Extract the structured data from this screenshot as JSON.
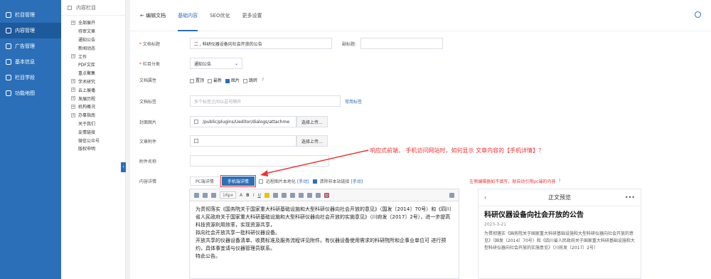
{
  "sidebar": {
    "items": [
      {
        "label": "栏目管理",
        "icon": "gear-icon"
      },
      {
        "label": "内容管理",
        "icon": "document-icon"
      },
      {
        "label": "广告管理",
        "icon": "home-icon"
      },
      {
        "label": "基本信息",
        "icon": "gear-icon"
      },
      {
        "label": "栏目学段",
        "icon": "document-icon"
      },
      {
        "label": "功能地图",
        "icon": "grid-icon"
      }
    ]
  },
  "tree": {
    "title": "内容栏目",
    "items": [
      {
        "label": "全部展开",
        "exp": "+"
      },
      {
        "label": "待审文章",
        "exp": ""
      },
      {
        "label": "通知公告",
        "exp": ""
      },
      {
        "label": "新闻动态",
        "exp": ""
      },
      {
        "label": "工作",
        "exp": "+"
      },
      {
        "label": "PDF文库",
        "exp": ""
      },
      {
        "label": "重点聚集",
        "exp": ""
      },
      {
        "label": "学术研究",
        "exp": "+"
      },
      {
        "label": "云上展播",
        "exp": "+"
      },
      {
        "label": "发展历程",
        "exp": "+"
      },
      {
        "label": "机构概况",
        "exp": "+"
      },
      {
        "label": "办事指南",
        "exp": "+"
      },
      {
        "label": "关于我们",
        "exp": ""
      },
      {
        "label": "友情链接",
        "exp": ""
      },
      {
        "label": "微信公众号",
        "exp": ""
      },
      {
        "label": "版权申明",
        "exp": ""
      }
    ],
    "collapse_glyph": "‹"
  },
  "header": {
    "back": "← 编辑文档",
    "tabs": [
      "基础内容",
      "SEO优化",
      "更多设置"
    ]
  },
  "form": {
    "title_label": "文档标题",
    "title_value": "二                     ,        科研仪器设备向社会开放的公告",
    "subtitle_label": "副标题:",
    "column_label": "栏目分类",
    "column_value": "通知公告",
    "attr_label": "文档属性",
    "attrs": [
      {
        "label": "置顶",
        "on": false
      },
      {
        "label": "最新",
        "on": false
      },
      {
        "label": "图片",
        "on": true
      },
      {
        "label": "跳转",
        "on": false
      }
    ],
    "attr_help": "?",
    "tags_label": "文档标签",
    "tags_placeholder": "多个标签之间以逗号隔开",
    "tags_link": "常用标签",
    "cover_label": "封面图片",
    "cover_value": "/public/plugins/Ueditor/dialogs/attachme",
    "upload": "选择上传...",
    "attach_label": "文章附件",
    "attach_value": "",
    "attachname_label": "附件名称",
    "content_label": "内容详情",
    "pc_btn": "PC端详情",
    "mobile_btn": "手机端详情",
    "remote_label": "远程图片本地化",
    "remote_manual": "[手动]",
    "clear_label": "清除非本站链接",
    "clear_manual": "[手动]",
    "right_hint": "左侧编辑器如不填写，就自动引用pc端的内容",
    "help": "?"
  },
  "annotation": "响应式前端， 手机访问网站时，如何显示 文章内容的【手机详情】？",
  "editor": {
    "fontsize": "16px",
    "paragraphs": [
      "为贯彻落实《国务院关于国家重大科研基础设施和大型科研仪器向社会开放的意见》（国发〔2014〕70号）和《四川省人民政府关于国家重大科研基础设施和大型科研仪器向社会开放的实施意见》（川府发〔2017〕2号），进一步提高科技资源利用效率，实现资源共享，",
      "拟向社会开放共享一批科研仪器设备。",
      "开放共享的仪器设备清单、收费标准及服务流程详见附件。有仪器设备使用需求的科研院所和企事业单位可                  进行预约，具体事宜请与仪器管理员联系。",
      "特此公告。"
    ]
  },
  "preview": {
    "header": "正文预览",
    "back": "‹",
    "more": "•••",
    "title": "科研仪器设备向社会开放的公告",
    "date": "2023-3-21",
    "body": "为贯彻落实《国务院关于国家重大科研基础设施和大型科研仪器向社会开放的意见》（国发〔2014〕70号）和《四川省人民政府关于国家重大科研基础设施和大型科研仪器向社会开放的实施意见》（川府发〔2017〕2号）"
  }
}
